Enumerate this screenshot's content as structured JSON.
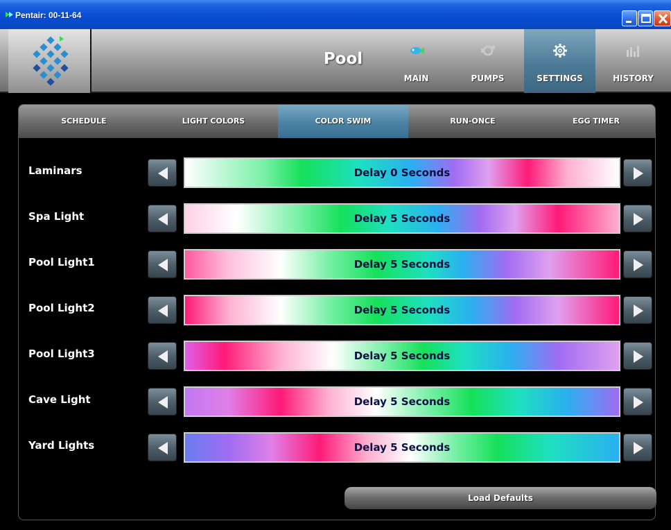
{
  "window": {
    "title": "Pentair: 00-11-64",
    "buttons": [
      "minimize-icon",
      "maximize-icon",
      "close-icon"
    ]
  },
  "header": {
    "logo": "pentair-logo",
    "title": "Pool",
    "nav": [
      {
        "label": "MAIN",
        "icon": "main-fish-icon",
        "active": false
      },
      {
        "label": "PUMPS",
        "icon": "pumps-icon",
        "active": false
      },
      {
        "label": "SETTINGS",
        "icon": "gear-icon",
        "active": true
      },
      {
        "label": "HISTORY",
        "icon": "bar-chart-icon",
        "active": false
      }
    ]
  },
  "tabs": [
    {
      "label": "SCHEDULE",
      "active": false
    },
    {
      "label": "LIGHT COLORS",
      "active": false
    },
    {
      "label": "COLOR SWIM",
      "active": true
    },
    {
      "label": "RUN-ONCE",
      "active": false
    },
    {
      "label": "EGG TIMER",
      "active": false
    }
  ],
  "rows": [
    {
      "label": "Laminars",
      "delay_text": "Delay 0 Seconds"
    },
    {
      "label": "Spa Light",
      "delay_text": "Delay 5 Seconds"
    },
    {
      "label": "Pool Light1",
      "delay_text": "Delay 5 Seconds"
    },
    {
      "label": "Pool Light2",
      "delay_text": "Delay 5 Seconds"
    },
    {
      "label": "Pool Light3",
      "delay_text": "Delay 5 Seconds"
    },
    {
      "label": "Cave Light",
      "delay_text": "Delay 5 Seconds"
    },
    {
      "label": "Yard Lights",
      "delay_text": "Delay 5 Seconds"
    }
  ],
  "load_defaults_label": "Load Defaults",
  "colors": {
    "titlebar": "#0a4fd4",
    "active_tab": "#4b83a4",
    "arrow_button": "#4f606b",
    "bar_text": "#0a1040"
  }
}
